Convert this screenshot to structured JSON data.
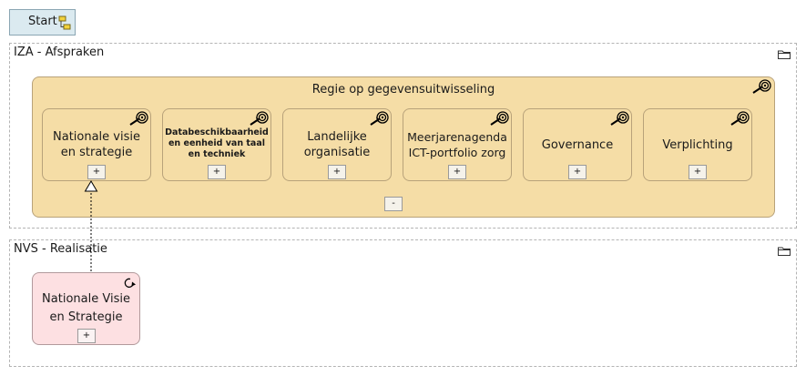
{
  "start": {
    "label": "Start",
    "icon": "hierarchy-icon"
  },
  "groups": [
    {
      "title": "IZA - Afspraken",
      "icon": "folder-icon"
    },
    {
      "title": "NVS - Realisatie",
      "icon": "folder-icon"
    }
  ],
  "regie": {
    "title": "Regie op gegevensuitwisseling",
    "icon": "goal-icon",
    "collapse_label": "-"
  },
  "goals": [
    {
      "label": "Nationale visie en strategie",
      "expand_label": "+"
    },
    {
      "label": "Databeschikbaarheid en eenheid van taal en techniek",
      "expand_label": "+"
    },
    {
      "label": "Landelijke organisatie",
      "expand_label": "+"
    },
    {
      "label": "Meerjarenagenda ICT-portfolio zorg",
      "expand_label": "+"
    },
    {
      "label": "Governance",
      "expand_label": "+"
    },
    {
      "label": "Verplichting",
      "expand_label": "+"
    }
  ],
  "nvs": {
    "label": "Nationale Visie en Strategie",
    "icon": "process-icon",
    "expand_label": "+"
  },
  "colors": {
    "goal_fill": "#f5dda6",
    "work_package_fill": "#fde0e2",
    "start_fill": "#dbeaf0"
  }
}
